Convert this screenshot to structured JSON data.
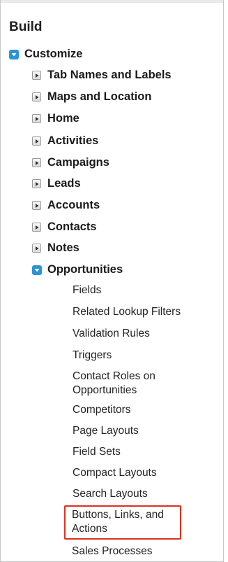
{
  "section": {
    "title": "Build"
  },
  "customize": {
    "label": "Customize",
    "icon": "expanded-toggle-icon"
  },
  "collapsed_items": [
    {
      "label": "Tab Names and Labels"
    },
    {
      "label": "Maps and Location"
    },
    {
      "label": "Home"
    },
    {
      "label": "Activities"
    },
    {
      "label": "Campaigns"
    },
    {
      "label": "Leads"
    },
    {
      "label": "Accounts"
    },
    {
      "label": "Contacts"
    },
    {
      "label": "Notes"
    }
  ],
  "opportunities": {
    "label": "Opportunities",
    "children": [
      {
        "label": "Fields"
      },
      {
        "label": "Related Lookup Filters"
      },
      {
        "label": "Validation Rules"
      },
      {
        "label": "Triggers"
      },
      {
        "label": "Contact Roles on Opportunities"
      },
      {
        "label": "Competitors"
      },
      {
        "label": "Page Layouts"
      },
      {
        "label": "Field Sets"
      },
      {
        "label": "Compact Layouts"
      },
      {
        "label": "Search Layouts"
      },
      {
        "label": "Buttons, Links, and Actions"
      },
      {
        "label": "Sales Processes"
      }
    ]
  },
  "colors": {
    "toggle_blue": "#2a94d6",
    "highlight_red": "#e0301e"
  }
}
